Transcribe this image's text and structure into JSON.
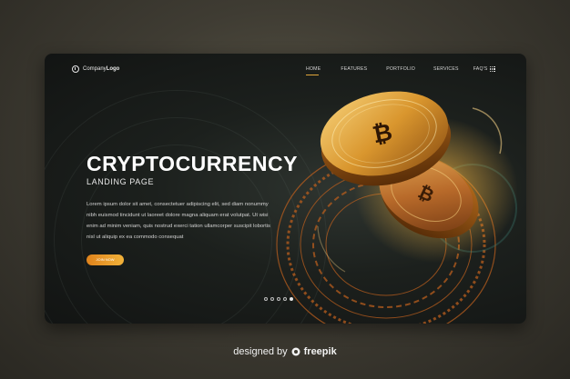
{
  "nav": {
    "logo_prefix": "Company",
    "logo_suffix": "Logo",
    "items": [
      {
        "label": "HOME",
        "active": true
      },
      {
        "label": "FEATURES",
        "active": false
      },
      {
        "label": "PORTFOLIO",
        "active": false
      },
      {
        "label": "SERVICES",
        "active": false
      },
      {
        "label": "FAQ'S",
        "active": false
      }
    ],
    "menu_icon": "grid-dots-icon"
  },
  "hero": {
    "title": "CRYPTOCURRENCY",
    "subtitle": "LANDING PAGE",
    "body_lines": [
      "Lorem ipsum dolor sit amet, consectetuer adipiscing elit, sed diam nonummy",
      "nibh euismod tincidunt ut laoreet dolore magna aliquam erat volutpat. Ut wisi",
      "enim ad minim veniam, quis nostrud exerci tation ullamcorper suscipit lobortis",
      "nisl ut aliquip ex ea commodo consequat"
    ],
    "button_label": "JOIN NOW",
    "coin_symbol": "₿"
  },
  "pager": {
    "count": 5,
    "active_index": 4
  },
  "footer": {
    "prefix": "designed by",
    "brand": "freepik",
    "icon": "freepik-icon"
  },
  "colors": {
    "accent": "#f2a93b",
    "gold": "#d9a441",
    "text": "#ffffff"
  }
}
